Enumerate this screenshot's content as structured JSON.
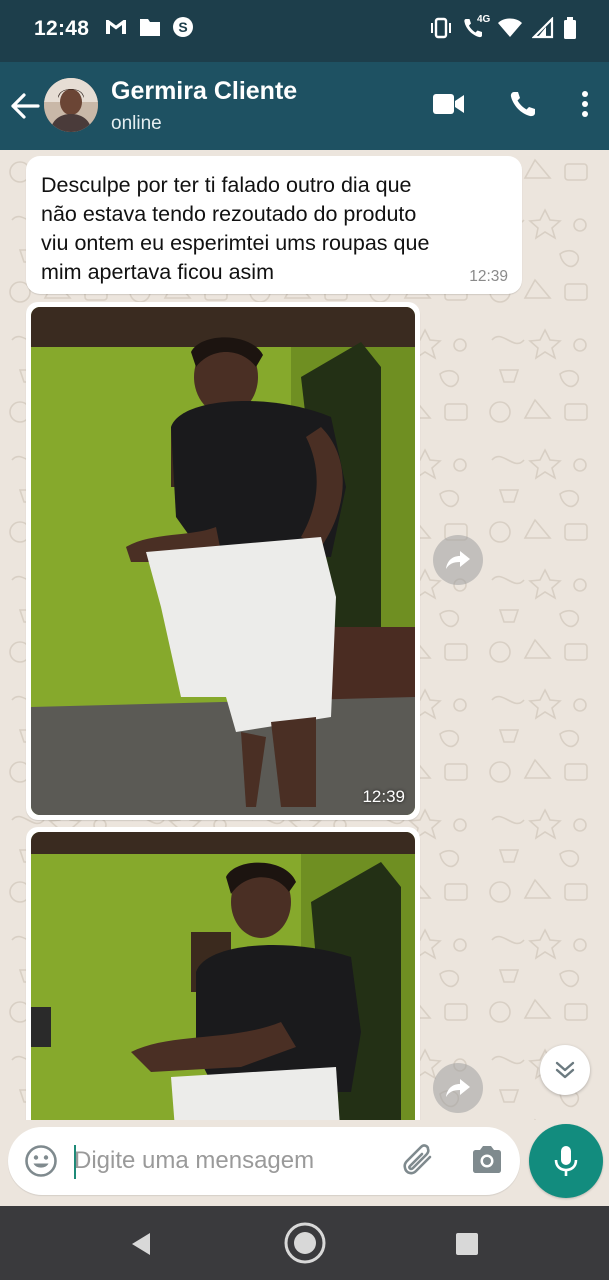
{
  "status_bar": {
    "time": "12:48",
    "left_icons": [
      "gmail-icon",
      "folder-icon",
      "s-badge-icon"
    ],
    "right_icons": [
      "vibrate-icon",
      "volte-call-icon",
      "wifi-icon",
      "signal-icon",
      "battery-icon"
    ],
    "network_label": "4G"
  },
  "header": {
    "contact_name": "Germira Cliente",
    "status": "online",
    "actions": [
      "video-call-icon",
      "phone-call-icon",
      "more-options-icon"
    ]
  },
  "messages": [
    {
      "type": "text",
      "text": "Desculpe por ter ti falado outro dia que\nnão estava tendo rezoutado  do produto\nviu ontem eu  esperimtei ums roupas que\nmim apertava ficou asim",
      "time": "12:39"
    },
    {
      "type": "image",
      "time": "12:39"
    },
    {
      "type": "image",
      "time": ""
    }
  ],
  "composer": {
    "placeholder": "Digite uma mensagem",
    "value": ""
  },
  "colors": {
    "status_bar": "#1d3e4b",
    "app_bar": "#1e5162",
    "accent": "#128c7e",
    "chat_bg": "#ece5dd",
    "nav_bar": "#3a3a3d"
  }
}
